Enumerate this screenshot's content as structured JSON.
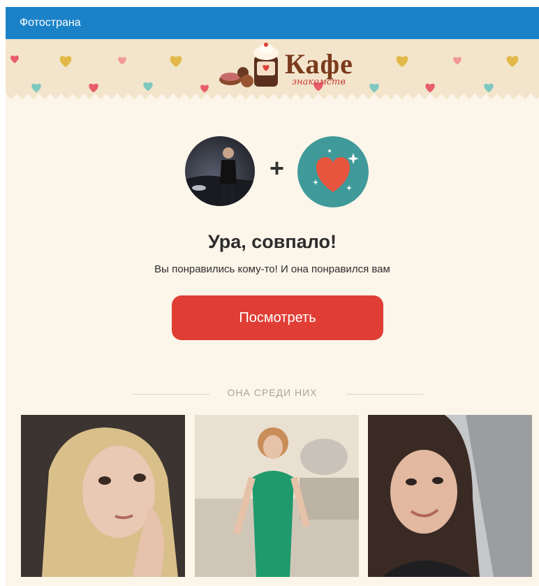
{
  "header": {
    "title": "Фотострана"
  },
  "banner": {
    "logo_title": "Кафе",
    "logo_subtitle": "знакомств",
    "heart_colors": [
      "#e2b948",
      "#7fc8bf",
      "#e85d6a",
      "#f29a9a"
    ]
  },
  "match": {
    "title": "Ура, совпало!",
    "subtitle": "Вы понравились кому-то! И она понравился вам",
    "plus": "+",
    "button_label": "Посмотреть"
  },
  "section": {
    "label": "ОНА СРЕДИ НИХ"
  },
  "photos": [
    {
      "icon": "woman-photo"
    },
    {
      "icon": "woman-photo"
    },
    {
      "icon": "woman-photo"
    }
  ],
  "colors": {
    "header": "#1b82c8",
    "accent": "#e03e35",
    "heart_circle": "#3f9a99",
    "background": "#fbf5ea"
  }
}
